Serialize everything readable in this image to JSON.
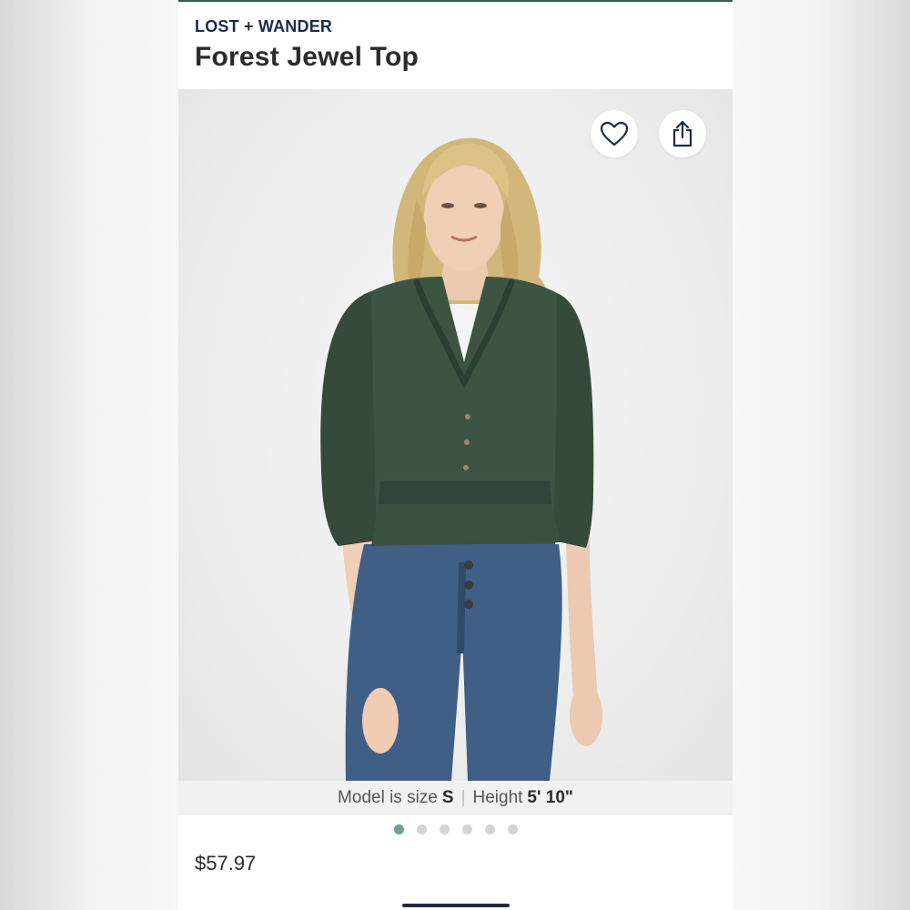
{
  "header": {
    "brand": "LOST + WANDER",
    "title": "Forest Jewel Top"
  },
  "photo": {
    "favorite_icon": "heart-outline-icon",
    "share_icon": "share-icon",
    "colors": {
      "top": "#3d5443",
      "jeans": "#3f5f86",
      "hair": "#d2b77a"
    }
  },
  "model_info": {
    "size_label": "Model is size",
    "size_value": "S",
    "separator": "|",
    "height_label": "Height",
    "height_value": "5' 10\""
  },
  "carousel": {
    "total": 6,
    "active_index": 1
  },
  "price": "$57.97",
  "colors": {
    "accent": "#2f5d57",
    "brand_text": "#1d2a4a",
    "active_dot": "#6aa39a"
  }
}
